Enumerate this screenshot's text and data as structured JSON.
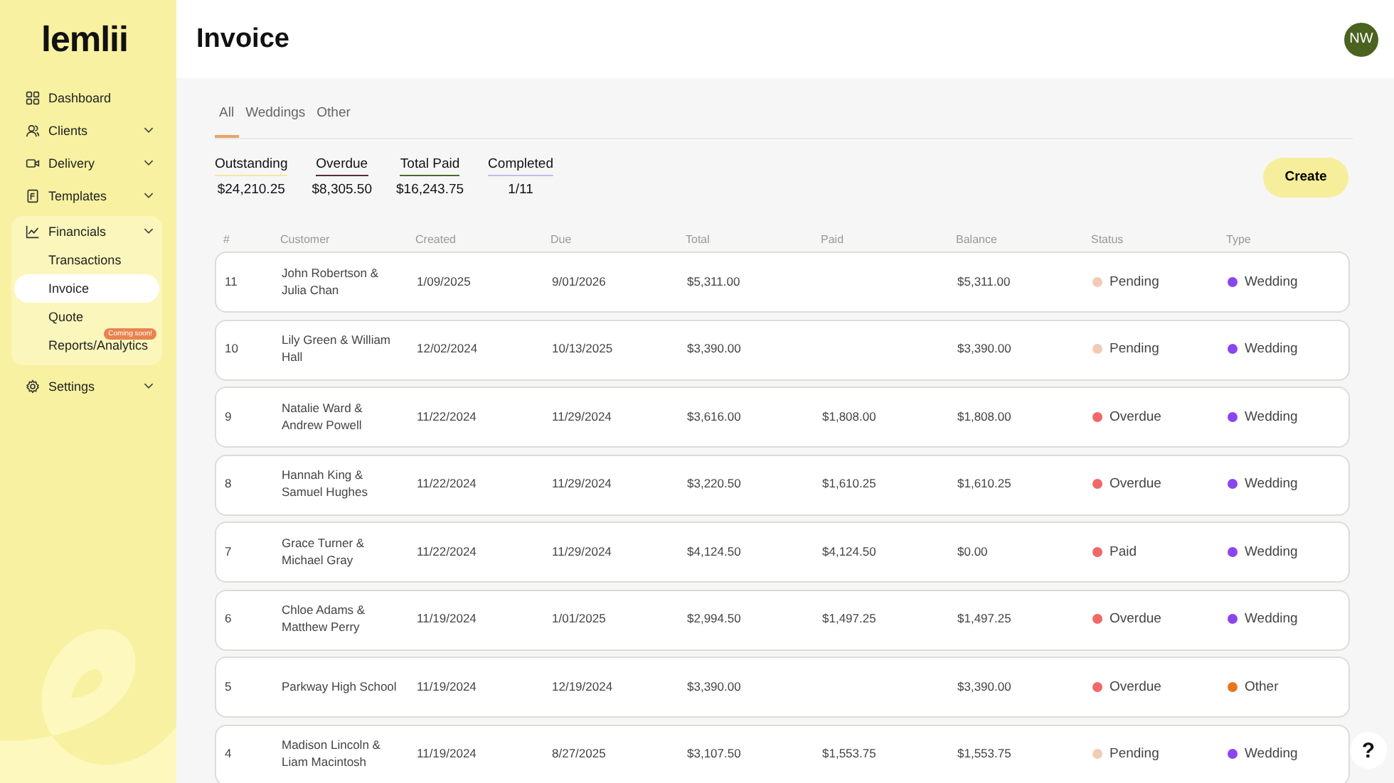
{
  "logo": "lemlii",
  "sidebar": {
    "items": [
      {
        "label": "Dashboard",
        "selected": false
      },
      {
        "label": "Clients",
        "selected": false,
        "expanded": false
      },
      {
        "label": "Delivery",
        "selected": false,
        "expanded": false
      },
      {
        "label": "Templates",
        "selected": false,
        "expanded": false
      },
      {
        "label": "Financials",
        "selected": false,
        "expanded": true,
        "children": [
          {
            "label": "Transactions",
            "selected": false
          },
          {
            "label": "Invoice",
            "selected": true
          },
          {
            "label": "Quote",
            "selected": false
          },
          {
            "label": "Reports/Analytics",
            "selected": false,
            "badge": "Coming soon!"
          }
        ]
      },
      {
        "label": "Settings",
        "selected": false,
        "expanded": false
      }
    ]
  },
  "header": {
    "title": "Invoice",
    "avatar": "NW"
  },
  "tabs": [
    {
      "label": "All",
      "selected": true
    },
    {
      "label": "Weddings",
      "selected": false
    },
    {
      "label": "Other",
      "selected": false
    }
  ],
  "stats": [
    {
      "label": "Outstanding",
      "value": "$24,210.25",
      "color": "#f5e7a0"
    },
    {
      "label": "Overdue",
      "value": "$8,305.50",
      "color": "#5c2a3a"
    },
    {
      "label": "Total Paid",
      "value": "$16,243.75",
      "color": "#4a6a2a"
    },
    {
      "label": "Completed",
      "value": "1/11",
      "color": "#c9b8f0"
    }
  ],
  "create_button": "Create",
  "table": {
    "columns": [
      "#",
      "Customer",
      "Created",
      "Due",
      "Total",
      "Paid",
      "Balance",
      "Status",
      "Type"
    ],
    "rows": [
      {
        "number": "11",
        "customer": "John Robertson & Julia Chan",
        "created": "1/09/2025",
        "due": "9/01/2026",
        "total": "$5,311.00",
        "balance": "$5,311.00",
        "status": {
          "label": "Pending",
          "color": "#f2cbb5"
        },
        "type": {
          "label": "Wedding",
          "color": "#8b45f0"
        }
      },
      {
        "number": "10",
        "customer": "Lily Green & William Hall",
        "created": "12/02/2024",
        "due": "10/13/2025",
        "total": "$3,390.00",
        "balance": "$3,390.00",
        "status": {
          "label": "Pending",
          "color": "#f2cbb5"
        },
        "type": {
          "label": "Wedding",
          "color": "#8b45f0"
        }
      },
      {
        "number": "9",
        "customer": "Natalie Ward & Andrew Powell",
        "created": "11/22/2024",
        "due": "11/29/2024",
        "total": "$3,616.00",
        "paid": "$1,808.00",
        "balance": "$1,808.00",
        "status": {
          "label": "Overdue",
          "color": "#f06868"
        },
        "type": {
          "label": "Wedding",
          "color": "#8b45f0"
        }
      },
      {
        "number": "8",
        "customer": "Hannah King & Samuel Hughes",
        "created": "11/22/2024",
        "due": "11/29/2024",
        "total": "$3,220.50",
        "paid": "$1,610.25",
        "balance": "$1,610.25",
        "status": {
          "label": "Overdue",
          "color": "#f06868"
        },
        "type": {
          "label": "Wedding",
          "color": "#8b45f0"
        }
      },
      {
        "number": "7",
        "customer": "Grace Turner & Michael Gray",
        "created": "11/22/2024",
        "due": "11/29/2024",
        "total": "$4,124.50",
        "paid": "$4,124.50",
        "balance": "$0.00",
        "status": {
          "label": "Paid",
          "color": "#f06868"
        },
        "type": {
          "label": "Wedding",
          "color": "#8b45f0"
        }
      },
      {
        "number": "6",
        "customer": "Chloe Adams & Matthew Perry",
        "created": "11/19/2024",
        "due": "1/01/2025",
        "total": "$2,994.50",
        "paid": "$1,497.25",
        "balance": "$1,497.25",
        "status": {
          "label": "Overdue",
          "color": "#f06868"
        },
        "type": {
          "label": "Wedding",
          "color": "#8b45f0"
        }
      },
      {
        "number": "5",
        "customer": "Parkway High School",
        "created": "11/19/2024",
        "due": "12/19/2024",
        "total": "$3,390.00",
        "balance": "$3,390.00",
        "status": {
          "label": "Overdue",
          "color": "#f06868"
        },
        "type": {
          "label": "Other",
          "color": "#e8761e"
        }
      },
      {
        "number": "4",
        "customer": "Madison Lincoln & Liam Macintosh",
        "created": "11/19/2024",
        "due": "8/27/2025",
        "total": "$3,107.50",
        "paid": "$1,553.75",
        "balance": "$1,553.75",
        "status": {
          "label": "Pending",
          "color": "#f2cbb5"
        },
        "type": {
          "label": "Wedding",
          "color": "#8b45f0"
        }
      }
    ]
  },
  "help_button": "?"
}
